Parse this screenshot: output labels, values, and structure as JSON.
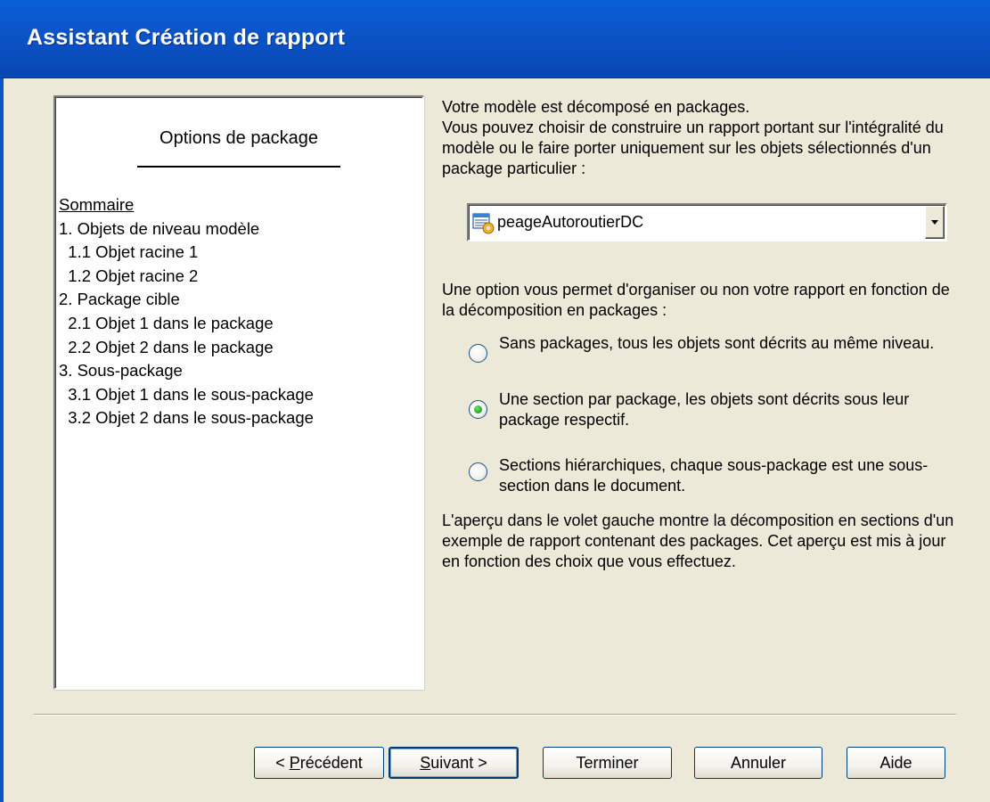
{
  "window": {
    "title": "Assistant Création de rapport"
  },
  "preview": {
    "heading": "Options de package",
    "summary_label": "Sommaire",
    "lines": [
      "1. Objets de niveau modèle",
      "  1.1 Objet racine 1",
      "  1.2 Objet racine 2",
      "2. Package cible",
      "  2.1 Objet 1 dans le package",
      "  2.2 Objet 2 dans le package",
      "3. Sous-package",
      "  3.1 Objet 1 dans le sous-package",
      "  3.2 Objet 2 dans le sous-package"
    ]
  },
  "intro": {
    "line1": "Votre modèle est décomposé en packages.",
    "line2": "Vous pouvez choisir de construire un rapport portant sur l'intégralité du modèle ou le faire porter uniquement sur les objets sélectionnés d'un package particulier :"
  },
  "package_select": {
    "value": "peageAutoroutierDC",
    "icon": "package-icon"
  },
  "option_intro": "Une option vous permet d'organiser ou non votre rapport en fonction de la décomposition en packages :",
  "options": [
    {
      "label": "Sans packages, tous les objets sont décrits au même niveau.",
      "selected": false
    },
    {
      "label": "Une section par package, les objets sont décrits sous leur package respectif.",
      "selected": true
    },
    {
      "label": "Sections hiérarchiques, chaque sous-package est une sous-section dans le document.",
      "selected": false
    }
  ],
  "preview_note": "L'aperçu dans le volet gauche montre la décomposition en sections d'un exemple de rapport contenant des packages. Cet aperçu est mis à jour en fonction des choix que vous effectuez.",
  "buttons": {
    "previous": {
      "prefix": "< ",
      "mnemonic": "P",
      "rest": "récédent"
    },
    "next": {
      "mnemonic": "S",
      "rest": "uivant >"
    },
    "finish": "Terminer",
    "cancel": "Annuler",
    "help": "Aide"
  },
  "colors": {
    "titlebar": "#0b55c9",
    "window_bg": "#ece9d8",
    "radio_selected": "#21a121"
  }
}
